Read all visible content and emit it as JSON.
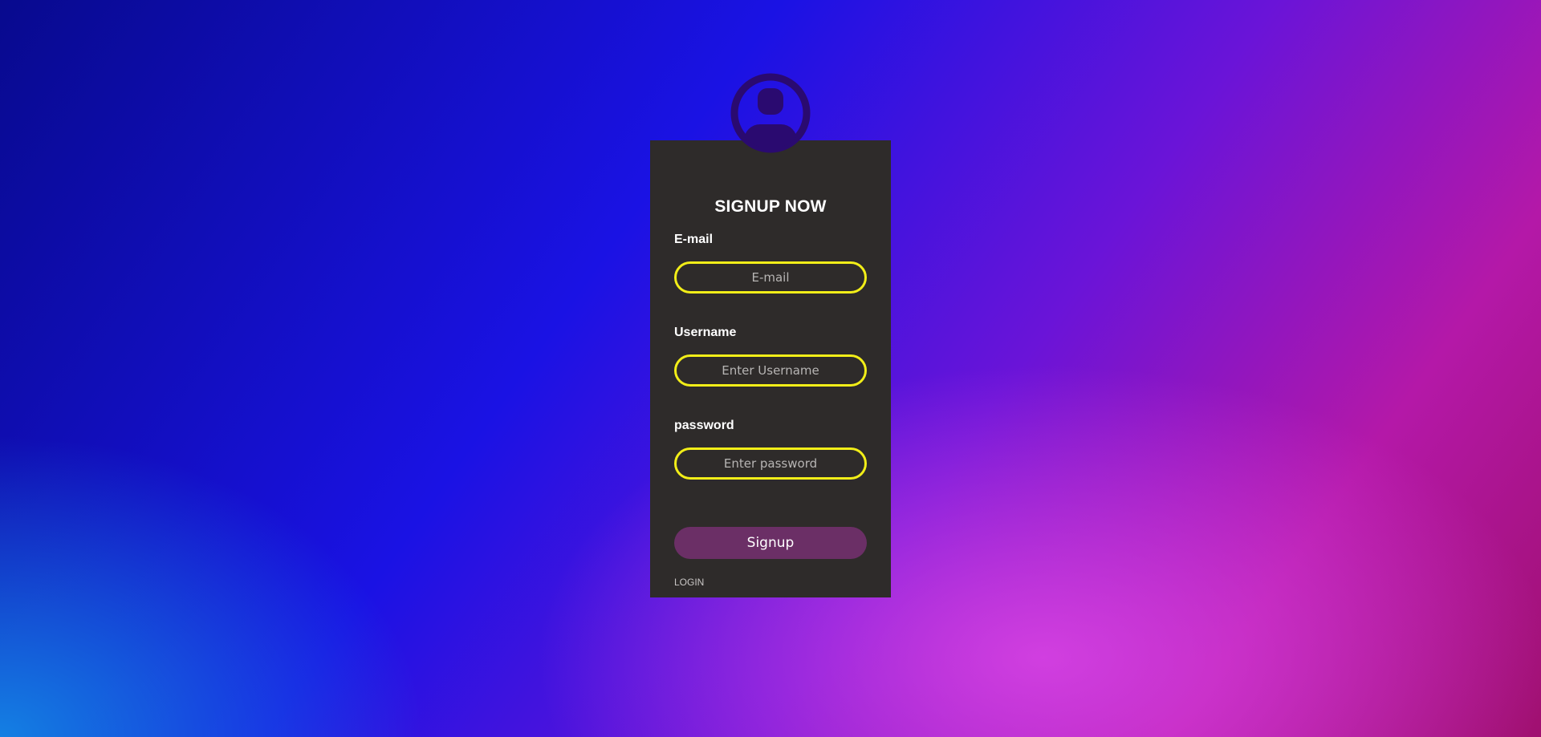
{
  "form": {
    "title": "SIGNUP NOW",
    "email_label": "E-mail",
    "email_placeholder": "E-mail",
    "username_label": "Username",
    "username_placeholder": "Enter Username",
    "password_label": "password",
    "password_placeholder": "Enter password",
    "submit_label": "Signup",
    "login_link": "LOGIN"
  },
  "icons": {
    "avatar": "user-avatar-icon"
  },
  "colors": {
    "card_background": "#2e2b2a",
    "input_border": "#f2ee18",
    "button_background": "#6b2f66",
    "avatar": "#2a0a70"
  }
}
